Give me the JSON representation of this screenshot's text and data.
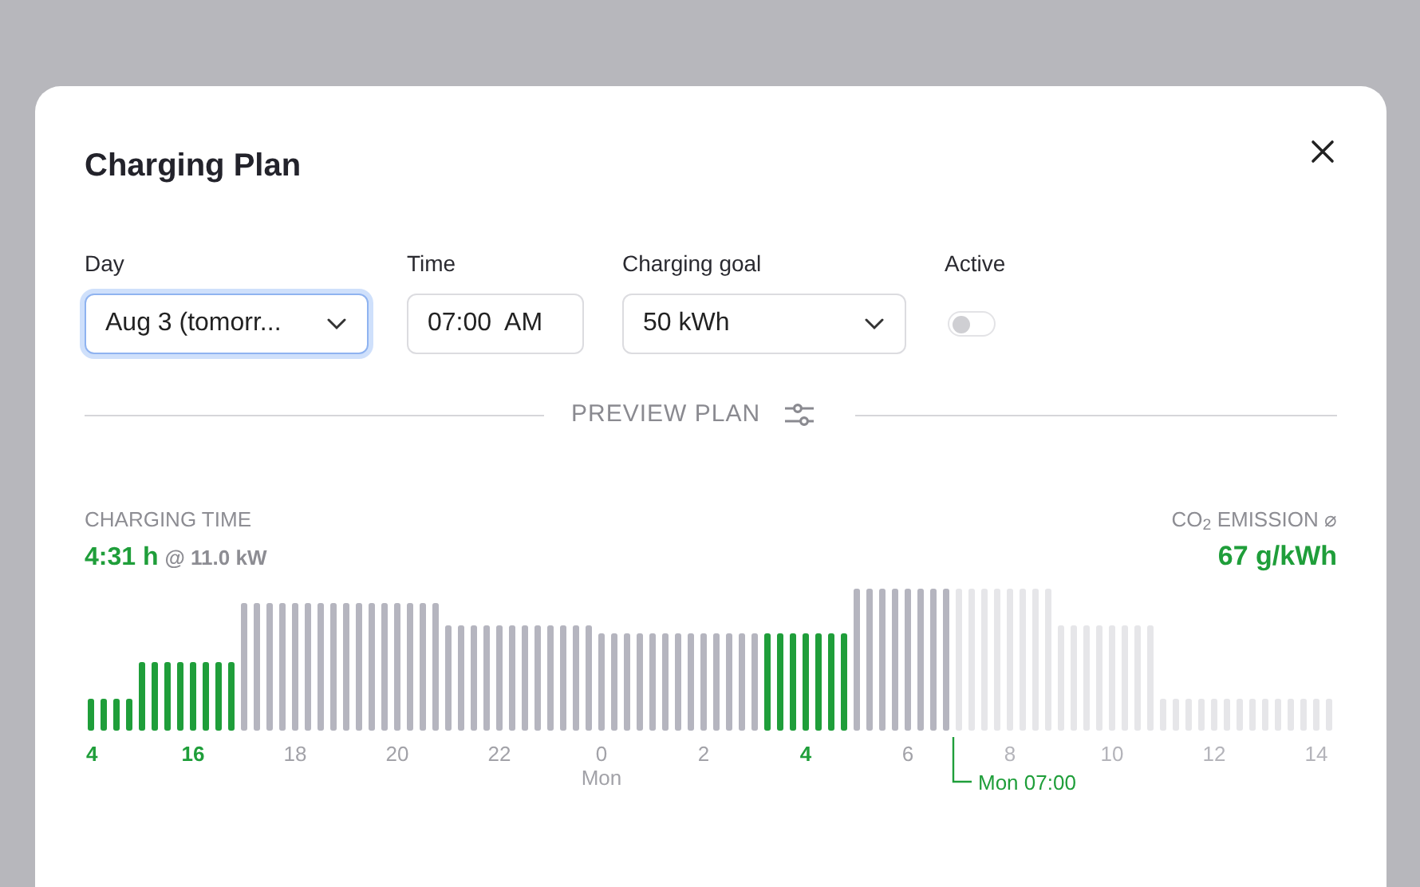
{
  "dialog": {
    "title": "Charging Plan"
  },
  "fields": [
    {
      "label": "Day",
      "kind": "select",
      "value": "Aug 3 (tomorr...",
      "focused": true
    },
    {
      "label": "Time",
      "kind": "time",
      "value": "07:00  AM",
      "focused": false
    },
    {
      "label": "Charging goal",
      "kind": "select",
      "value": "50 kWh",
      "focused": false
    },
    {
      "label": "Active",
      "kind": "toggle",
      "on": false,
      "focused": false
    }
  ],
  "divider": {
    "label": "PREVIEW PLAN"
  },
  "charging_time": {
    "label": "CHARGING TIME",
    "value": "4:31 h",
    "power": "@ 11.0 kW"
  },
  "co2_emission": {
    "label": "CO$_{2}$ EMISSION ⌀",
    "value": "67 g/kWh"
  },
  "chart": {
    "x_labels": [
      {
        "text": "4",
        "kind": "charging"
      },
      {
        "text": "16",
        "kind": "charging"
      },
      {
        "text": "18",
        "kind": "planned"
      },
      {
        "text": "20",
        "kind": "planned"
      },
      {
        "text": "22",
        "kind": "planned"
      },
      {
        "text": "0",
        "kind": "planned"
      },
      {
        "text": "2",
        "kind": "planned"
      },
      {
        "text": "4",
        "kind": "charging"
      },
      {
        "text": "6",
        "kind": "planned"
      },
      {
        "text": "8",
        "kind": "after"
      },
      {
        "text": "10",
        "kind": "after"
      },
      {
        "text": "12",
        "kind": "after"
      },
      {
        "text": "14",
        "kind": "after"
      }
    ],
    "day_label": "Mon",
    "deadline_label": "Mon 07:00"
  }
}
